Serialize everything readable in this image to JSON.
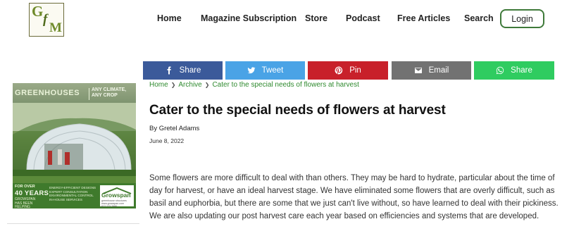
{
  "logo": {
    "g": "G",
    "f": "f",
    "m": "M"
  },
  "nav": {
    "home": "Home",
    "magazine": "Magazine Subscription",
    "store": "Store",
    "podcast": "Podcast",
    "free": "Free Articles",
    "search": "Search",
    "login": "Login"
  },
  "share": {
    "facebook": "Share",
    "twitter": "Tweet",
    "pinterest": "Pin",
    "email": "Email",
    "whatsapp": "Share"
  },
  "colors": {
    "facebook": "#3b5a9a",
    "twitter": "#4aa3e6",
    "pinterest": "#c8202a",
    "email": "#727272",
    "whatsapp": "#2fcc60",
    "accent_green": "#2f8a2f"
  },
  "breadcrumb": {
    "home": "Home",
    "archive": "Archive",
    "current": "Cater to the special needs of flowers at harvest"
  },
  "article": {
    "title": "Cater to the special needs of flowers at harvest",
    "byline": "By Gretel Adams",
    "date": "June 8, 2022",
    "body": "Some flowers are more difficult to deal with than others. They may be hard to hydrate, particular about the time of day for harvest, or have an ideal harvest stage.  We have eliminated some flowers that are overly difficult, such as basil and euphorbia, but there are some that we just can't live without, so have learned to deal with their pickiness. We are also updating our post harvest care each year based on efficiencies and systems that are developed."
  },
  "ad": {
    "headline": "GREENHOUSES",
    "sub1": "ANY CLIMATE,",
    "sub2": "ANY CROP",
    "for_over": "FOR OVER",
    "years": "40 YEARS",
    "tagline": "GROWSPAN HAS BEEN HELPING GROWERS",
    "features": "ENERGY-EFFICIENT DESIGNS\nEXPERT CONSULTATION\nENVIRONMENTAL CONTROL\nIN-HOUSE SERVICES",
    "brand": "Growspan",
    "brand_sub": "greenhouse structures",
    "url": "www.growspan.com",
    "phone": "877.273.7996"
  }
}
